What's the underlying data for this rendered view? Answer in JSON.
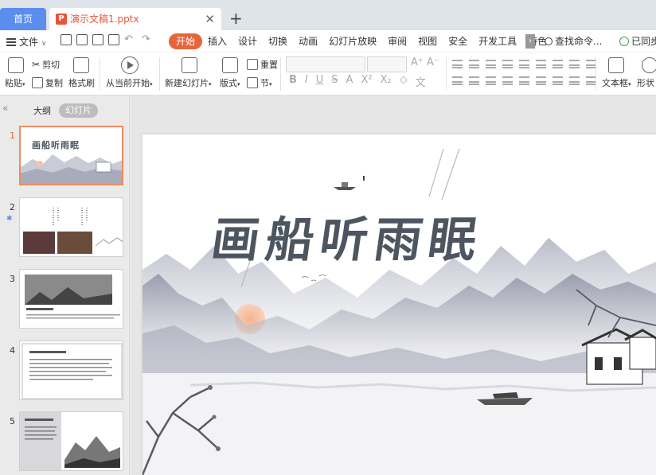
{
  "tabs": {
    "home_label": "首页",
    "doc_title": "演示文稿1.pptx",
    "ppt_glyph": "P"
  },
  "menu": {
    "file_label": "文件",
    "items": [
      "开始",
      "插入",
      "设计",
      "切换",
      "动画",
      "幻灯片放映",
      "审阅",
      "视图",
      "安全",
      "开发工具",
      "特色"
    ],
    "active_index": 0,
    "search_label": "查找命令...",
    "sync_label": "已同步"
  },
  "ribbon": {
    "paste": "粘贴",
    "cut": "剪切",
    "copy": "复制",
    "format_painter": "格式刷",
    "from_current": "从当前开始",
    "new_slide": "新建幻灯片",
    "layout": "版式",
    "reset": "重置",
    "section": "节",
    "textbox": "文本框",
    "shape": "形状",
    "fmt_glyphs": [
      "B",
      "I",
      "U",
      "S",
      "A",
      "X²",
      "X₂",
      "◇",
      "文"
    ],
    "font_glyphs": [
      "A⁺",
      "A⁻"
    ]
  },
  "panel": {
    "outline_label": "大纲",
    "slides_label": "幻灯片",
    "collapse_glyph": "«",
    "slide_numbers": [
      "1",
      "2",
      "3",
      "4",
      "5"
    ],
    "current_slide": 1
  },
  "slide": {
    "title": "画船听雨眠"
  },
  "colors": {
    "accent_orange": "#e8643a",
    "home_tab_blue": "#5b8def",
    "title_ink": "#4d5660"
  }
}
